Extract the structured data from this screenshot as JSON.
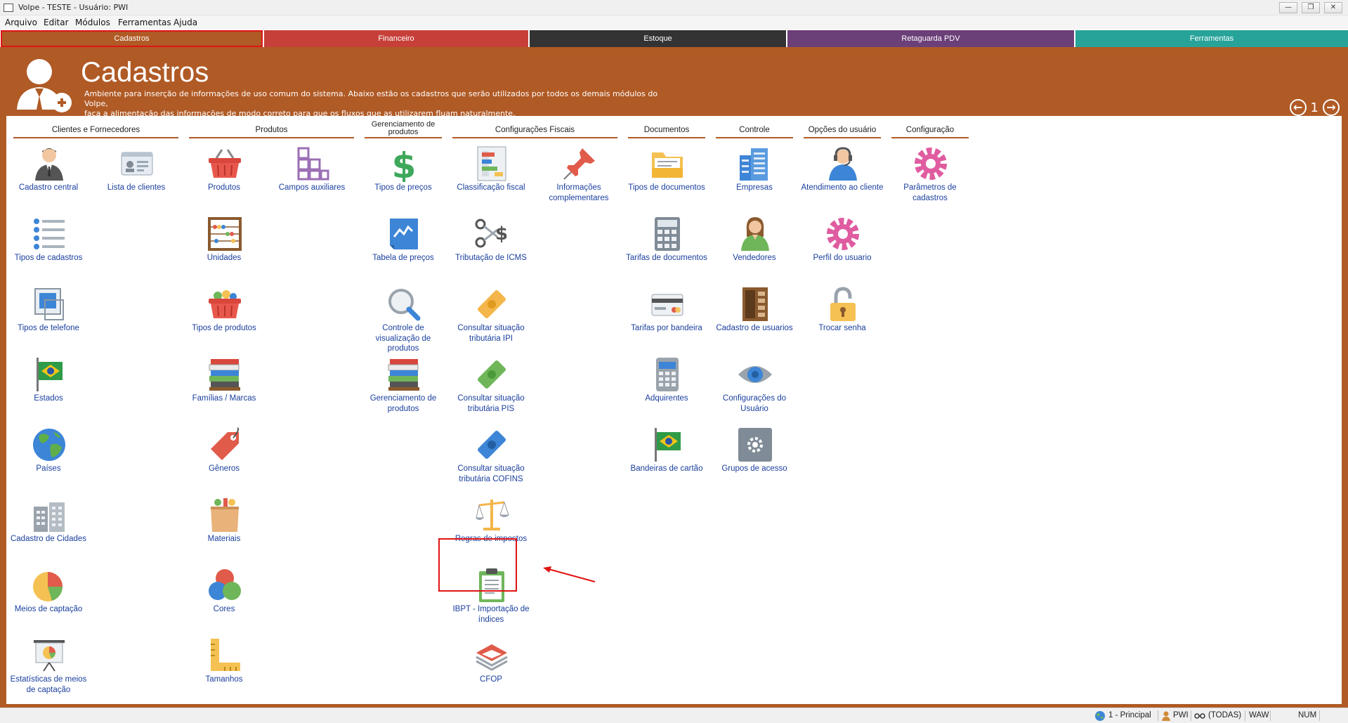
{
  "window": {
    "title": "Volpe - TESTE - Usuário: PWI"
  },
  "menu": [
    "Arquivo",
    "Editar",
    "Módulos",
    "Ferramentas",
    "Ajuda"
  ],
  "tabs": [
    {
      "label": "Cadastros",
      "color": "#b05a25"
    },
    {
      "label": "Financeiro",
      "color": "#c64039"
    },
    {
      "label": "Estoque",
      "color": "#333333"
    },
    {
      "label": "Retaguarda PDV",
      "color": "#6b3f78"
    },
    {
      "label": "Ferramentas",
      "color": "#27a39a"
    }
  ],
  "header": {
    "title": "Cadastros",
    "description_line1": "Ambiente para inserção de informações de uso comum do sistema. Abaixo estão os cadastros que serão utilizados por todos os demais módulos do Volpe,",
    "description_line2": "faça a alimentação das informações de modo correto para que os fluxos que as utilizarem fluam naturalmente.",
    "page_number": "1"
  },
  "columns": [
    {
      "title": "Clientes e Fornecedores"
    },
    {
      "title": "Produtos"
    },
    {
      "title": "Gerenciamento de produtos"
    },
    {
      "title": "Configurações Fiscais"
    },
    {
      "title": "Documentos"
    },
    {
      "title": "Controle"
    },
    {
      "title": "Opções do usuário"
    },
    {
      "title": "Configuração"
    }
  ],
  "tiles": {
    "cadastro_central": "Cadastro central",
    "lista_clientes": "Lista de clientes",
    "tipos_cadastros": "Tipos de cadastros",
    "tipos_telefone": "Tipos de telefone",
    "estados": "Estados",
    "paises": "Países",
    "cadastro_cidades": "Cadastro de Cidades",
    "meios_captacao": "Meios de captação",
    "estatisticas": "Estatísticas de meios de captação",
    "produtos": "Produtos",
    "campos_auxiliares": "Campos auxiliares",
    "unidades": "Unidades",
    "tipos_produtos": "Tipos de produtos",
    "familias": "Famílias / Marcas",
    "generos": "Gêneros",
    "materiais": "Materiais",
    "cores": "Cores",
    "tamanhos": "Tamanhos",
    "tipos_precos": "Tipos de preços",
    "tabela_precos": "Tabela de preços",
    "controle_visualizacao": "Controle de visualização de produtos",
    "gerenciamento_produtos": "Gerenciamento de produtos",
    "classificacao_fiscal": "Classificação fiscal",
    "informacoes_complementares": "Informações complementares",
    "tributacao_icms": "Tributação de ICMS",
    "consultar_ipi": "Consultar situação tributária IPI",
    "consultar_pis": "Consultar situação tributária PIS",
    "consultar_cofins": "Consultar situação tributária COFINS",
    "regras_impostos": "Regras de impostos",
    "ibpt": "IBPT - Importação de índices",
    "cfop": "CFOP",
    "tipos_documentos": "Tipos de documentos",
    "tarifas_documentos": "Tarifas de documentos",
    "tarifas_bandeira": "Tarifas por bandeira",
    "adquirentes": "Adquirentes",
    "bandeiras_cartao": "Bandeiras de cartão",
    "empresas": "Empresas",
    "vendedores": "Vendedores",
    "cadastro_usuarios": "Cadastro de usuarios",
    "configuracoes_usuario": "Configurações do Usuário",
    "grupos_acesso": "Grupos de acesso",
    "atendimento_cliente": "Atendimento ao cliente",
    "perfil_usuario": "Perfil do usuario",
    "trocar_senha": "Trocar senha",
    "parametros_cadastros": "Parâmetros de cadastros"
  },
  "statusbar": {
    "principal": "1 - Principal",
    "user": "PWI",
    "todas": "(TODAS)",
    "waw": "WAW",
    "num": "NUM"
  },
  "accent": "#b05a25",
  "highlight_color": "#e01414"
}
